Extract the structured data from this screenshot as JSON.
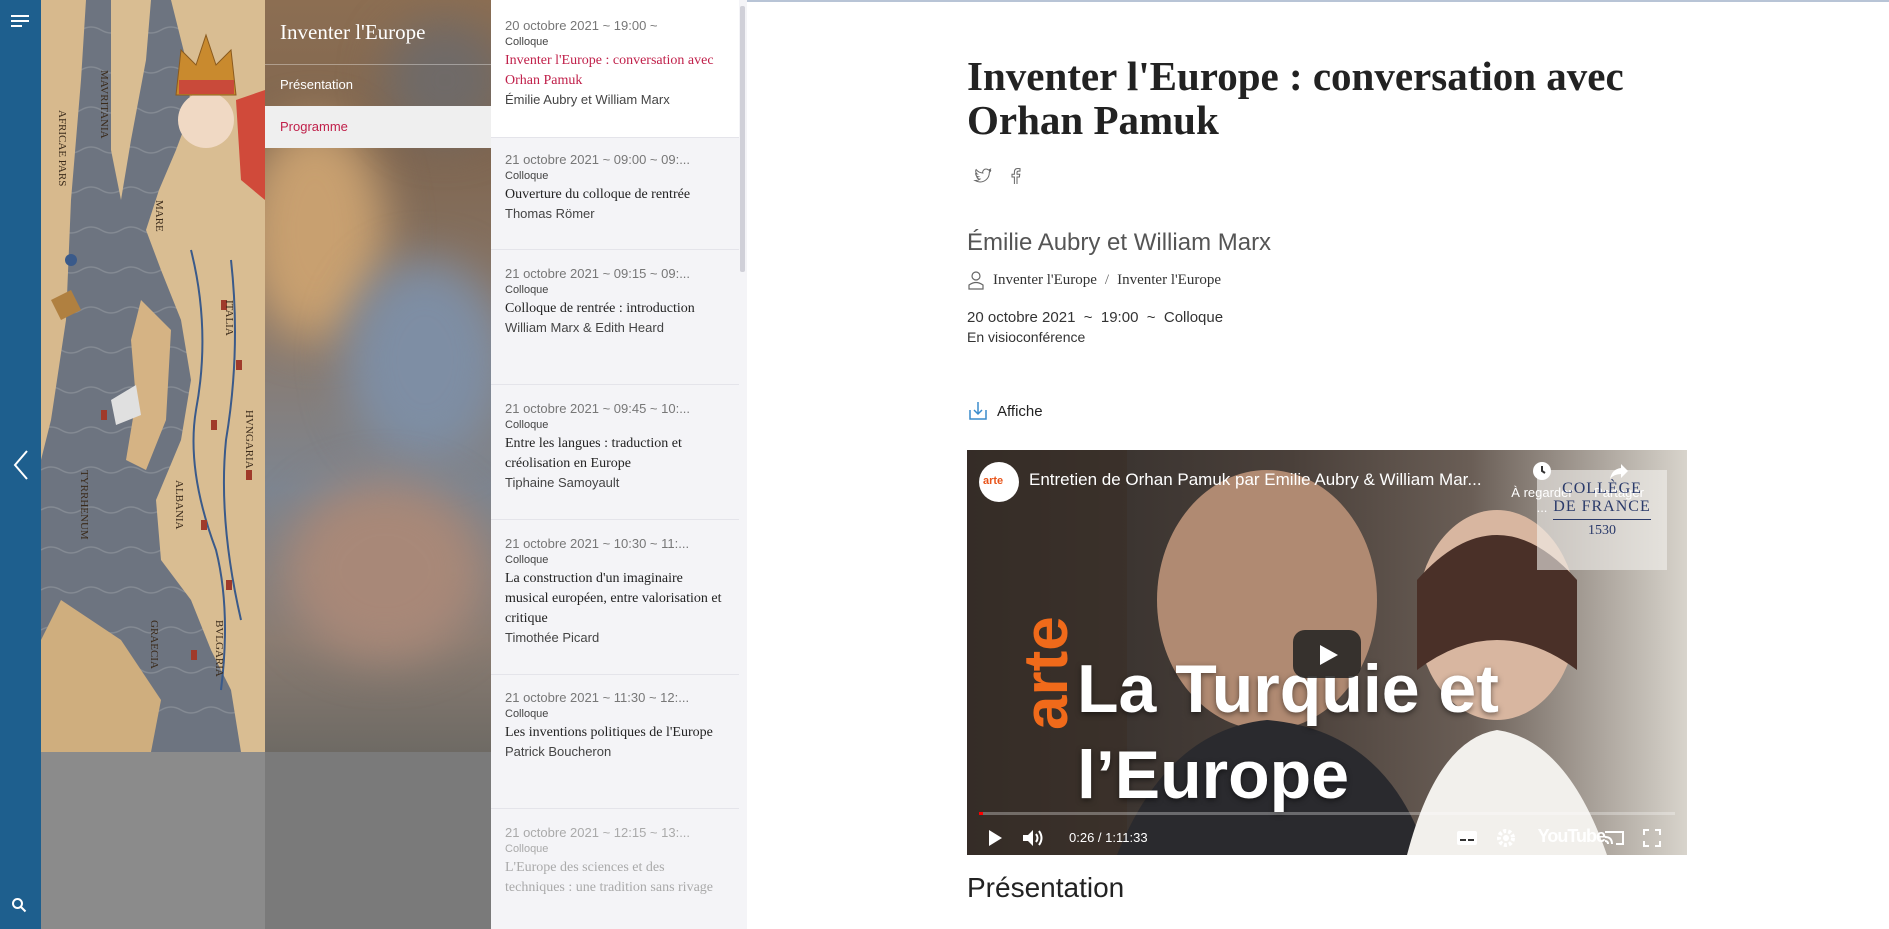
{
  "site": {
    "title": "Inventer l'Europe"
  },
  "nav": {
    "items": [
      {
        "label": "Présentation"
      },
      {
        "label": "Programme"
      }
    ]
  },
  "programme": [
    {
      "meta": "20 octobre 2021  ~  19:00  ~",
      "type": "Colloque",
      "title": "Inventer l'Europe : conversation avec Orhan Pamuk",
      "speaker": "Émilie Aubry et William Marx"
    },
    {
      "meta": "21 octobre 2021  ~  09:00  ~  09:...",
      "type": "Colloque",
      "title": "Ouverture du colloque de rentrée",
      "speaker": "Thomas Römer"
    },
    {
      "meta": "21 octobre 2021  ~  09:15  ~  09:...",
      "type": "Colloque",
      "title": "Colloque de rentrée : introduction",
      "speaker": "William Marx & Edith Heard"
    },
    {
      "meta": "21 octobre 2021  ~  09:45  ~  10:...",
      "type": "Colloque",
      "title": "Entre les langues : traduction et créolisation en Europe",
      "speaker": "Tiphaine Samoyault"
    },
    {
      "meta": "21 octobre 2021  ~  10:30  ~  11:...",
      "type": "Colloque",
      "title": "La construction d'un imaginaire musical européen, entre valorisation et critique",
      "speaker": "Timothée Picard"
    },
    {
      "meta": "21 octobre 2021  ~  11:30  ~  12:...",
      "type": "Colloque",
      "title": "Les inventions politiques de l'Europe",
      "speaker": "Patrick Boucheron"
    },
    {
      "meta": "21 octobre 2021  ~  12:15  ~  13:...",
      "type": "Colloque",
      "title": "L'Europe des sciences et des techniques : une tradition sans rivage",
      "speaker": ""
    }
  ],
  "event": {
    "title": "Inventer l'Europe : conversation avec Orhan Pamuk",
    "speakers": "Émilie Aubry et William Marx",
    "breadcrumb": [
      "Inventer l'Europe",
      "Inventer l'Europe"
    ],
    "date": "20 octobre 2021",
    "time": "19:00",
    "type": "Colloque",
    "location": "En visioconférence",
    "affiche_label": "Affiche"
  },
  "video": {
    "title": "Entretien de Orhan Pamuk par Emilie Aubry & William Mar...",
    "channel_logo_text": "arte",
    "watch_later": "À regarder ...",
    "share": "Partager",
    "cdf_line1": "COLLÈGE",
    "cdf_line2": "DE FRANCE",
    "cdf_line3": "1530",
    "arte_text": "arte",
    "headline_line1": "La Turquie et",
    "headline_line2": "l’Europe",
    "time": "0:26 / 1:11:33",
    "platform": "YouTube",
    "progress": 0.006
  },
  "section": {
    "presentation_heading": "Présentation"
  },
  "colors": {
    "rail": "#1e5f8e",
    "accent": "#c0204a"
  }
}
